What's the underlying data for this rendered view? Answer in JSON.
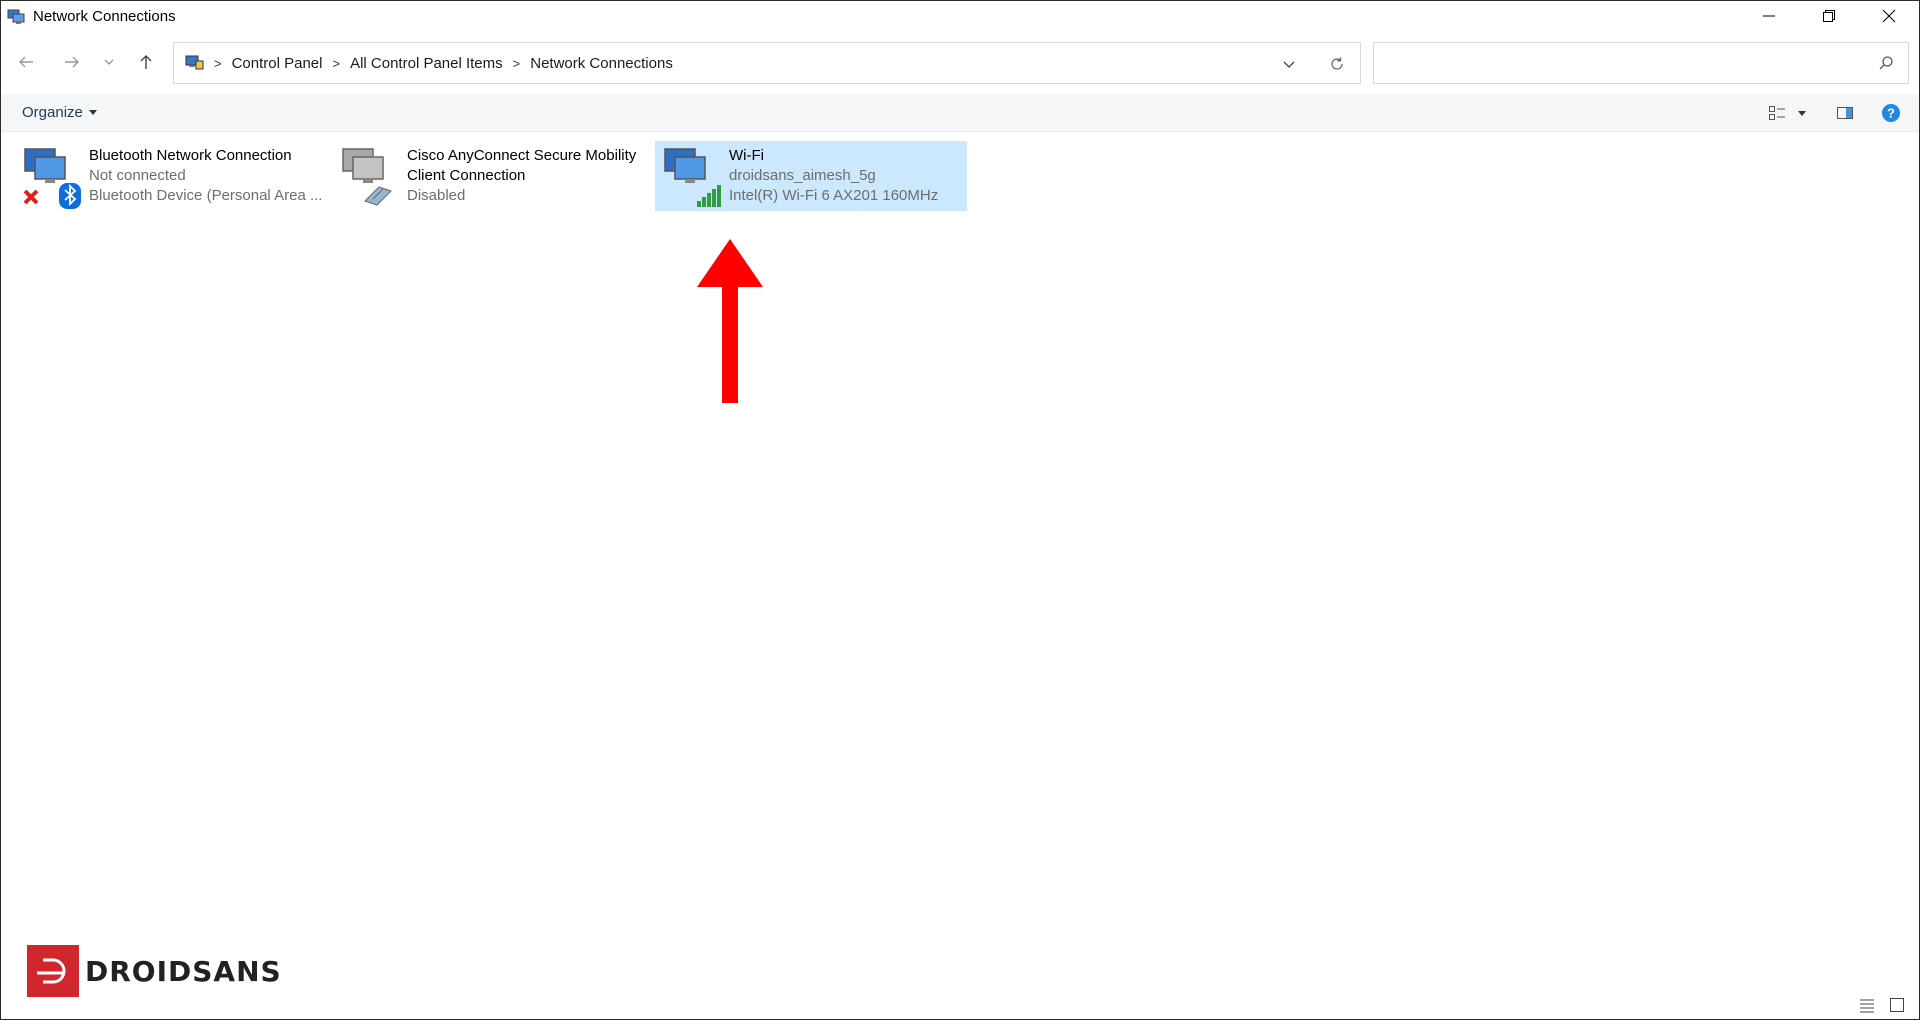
{
  "window": {
    "title": "Network Connections",
    "controls": [
      "minimize-icon",
      "restore-icon",
      "close-icon"
    ]
  },
  "nav": {
    "back_icon": "arrow-left-icon",
    "forward_icon": "arrow-right-icon",
    "recent_icon": "chevron-down-icon",
    "up_icon": "arrow-up-icon",
    "breadcrumb": [
      "Control Panel",
      "All Control Panel Items",
      "Network Connections"
    ],
    "search_placeholder": ""
  },
  "command_bar": {
    "organize_label": "Organize"
  },
  "connections": [
    {
      "name": "Bluetooth Network Connection",
      "status": "Not connected",
      "device": "Bluetooth Device (Personal Area ...",
      "icon": "bluetooth-network-icon",
      "selected": false
    },
    {
      "name": "Cisco AnyConnect Secure Mobility",
      "name_line2": "Client Connection",
      "status": "Disabled",
      "icon": "cisco-adapter-icon",
      "selected": false
    },
    {
      "name": "Wi-Fi",
      "status": "droidsans_aimesh_5g",
      "device": "Intel(R) Wi-Fi 6 AX201 160MHz",
      "icon": "wifi-network-icon",
      "selected": true
    }
  ],
  "annotation": {
    "arrow_color": "#ff0000"
  },
  "watermark": {
    "text": "DROIDSANS",
    "color": "#d0272d"
  },
  "colors": {
    "selection": "#cce8ff",
    "help": "#1e88e5"
  }
}
